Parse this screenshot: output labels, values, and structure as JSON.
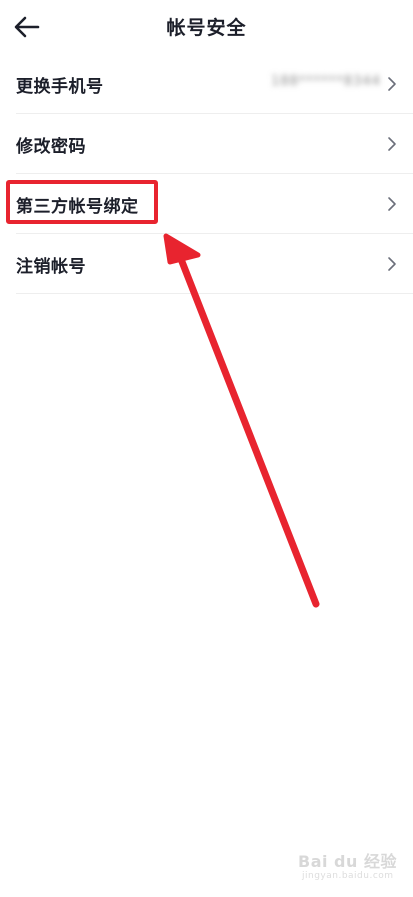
{
  "header": {
    "title": "帐号安全",
    "back_icon": "arrow-left-icon"
  },
  "settings": {
    "items": [
      {
        "label": "更换手机号",
        "value": "188******8344"
      },
      {
        "label": "修改密码",
        "value": ""
      },
      {
        "label": "第三方帐号绑定",
        "value": ""
      },
      {
        "label": "注销帐号",
        "value": ""
      }
    ]
  },
  "annotation": {
    "color": "#e8242f",
    "highlighted_item": "第三方帐号绑定"
  },
  "watermark": {
    "logo": "Bai du 经验",
    "url": "jingyan.baidu.com"
  }
}
